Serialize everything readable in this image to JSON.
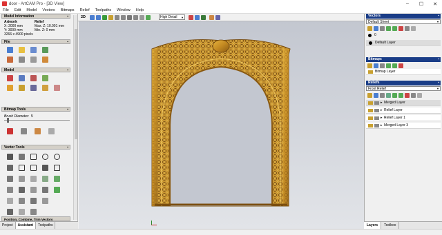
{
  "window": {
    "title": "door - ArtCAM Pro - [3D View]",
    "controls": [
      "–",
      "☐",
      "✕"
    ]
  },
  "menu": [
    "File",
    "Edit",
    "Model",
    "Vectors",
    "Bitmaps",
    "Relief",
    "Toolpaths",
    "Window",
    "Help"
  ],
  "left": {
    "model_info": {
      "header": "Model Information",
      "artwork_label": "Artwork",
      "relief_label": "Relief",
      "x": "X: 2000 mm",
      "y": "Y: 3000 mm",
      "maxz": "Max. Z: 10.001 mm",
      "minz": "Min. Z: 0 mm",
      "pixels": "3266 x 4900 pixels"
    },
    "file_header": "File",
    "model_header": "Model",
    "bitmap_tools_header": "Bitmap Tools",
    "brush_label": "Brush Diameter:",
    "brush_value": "5",
    "vector_tools_header": "Vector Tools",
    "position_header": "Position, Combine, Trim Vectors",
    "tabs": [
      "Project",
      "Assistant",
      "Toolpaths"
    ]
  },
  "toolbar": {
    "mode": "2D",
    "detail": "High Detail"
  },
  "right": {
    "vectors_header": "Vectors",
    "vectors_sheet": "Default Sheet",
    "vectors_zero": "0",
    "vector_layer": "Default Layer",
    "bitmaps_header": "Bitmaps",
    "bitmap_layer": "Bitmap Layer",
    "reliefs_header": "Reliefs",
    "relief_set": "Front Relief",
    "relief_layers": [
      "Merged Layer",
      "Relief Layer",
      "Relief Layer 1",
      "Merged Layer 3"
    ],
    "tabs": [
      "Layers",
      "Toolbox"
    ]
  },
  "colors": {
    "accent": "#1a3d87",
    "gold": "#c9952b",
    "bg": "#c6cad2"
  }
}
